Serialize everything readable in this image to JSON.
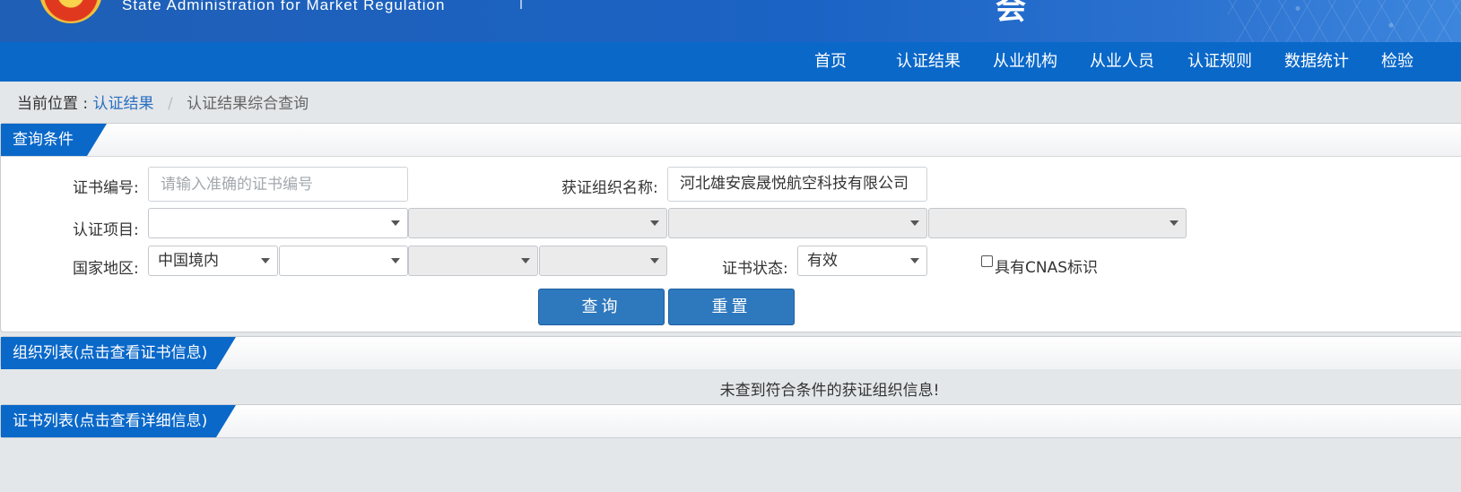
{
  "header": {
    "en_title": "State Administration  for  Market Regulation",
    "cn_title_fragment": "会"
  },
  "nav": {
    "items": [
      "首页",
      "认证结果",
      "从业机构",
      "从业人员",
      "认证规则",
      "数据统计",
      "检验"
    ]
  },
  "breadcrumb": {
    "prefix": "当前位置 :",
    "link": "认证结果",
    "separator": "/",
    "current": "认证结果综合查询"
  },
  "query_panel": {
    "tab_label": "查询条件",
    "cert_no_label": "证书编号:",
    "cert_no_placeholder": "请输入准确的证书编号",
    "cert_no_value": "",
    "org_name_label": "获证组织名称:",
    "org_name_value": "河北雄安宸晟悦航空科技有限公司",
    "project_label": "认证项目:",
    "project_selects": [
      "",
      "",
      "",
      ""
    ],
    "region_label": "国家地区:",
    "region_selects": [
      "中国境内",
      "",
      "",
      ""
    ],
    "status_label": "证书状态:",
    "status_value": "有效",
    "cnas_label": "具有CNAS标识",
    "cnas_checked": false,
    "search_button": "查询",
    "reset_button": "重置"
  },
  "org_list": {
    "tab_label": "组织列表(点击查看证书信息)",
    "empty_message": "未查到符合条件的获证组织信息!"
  },
  "cert_list": {
    "tab_label": "证书列表(点击查看详细信息)"
  },
  "colors": {
    "nav_bg": "#0a68c9",
    "button_bg": "#2e78be",
    "link": "#2a6fbf"
  }
}
